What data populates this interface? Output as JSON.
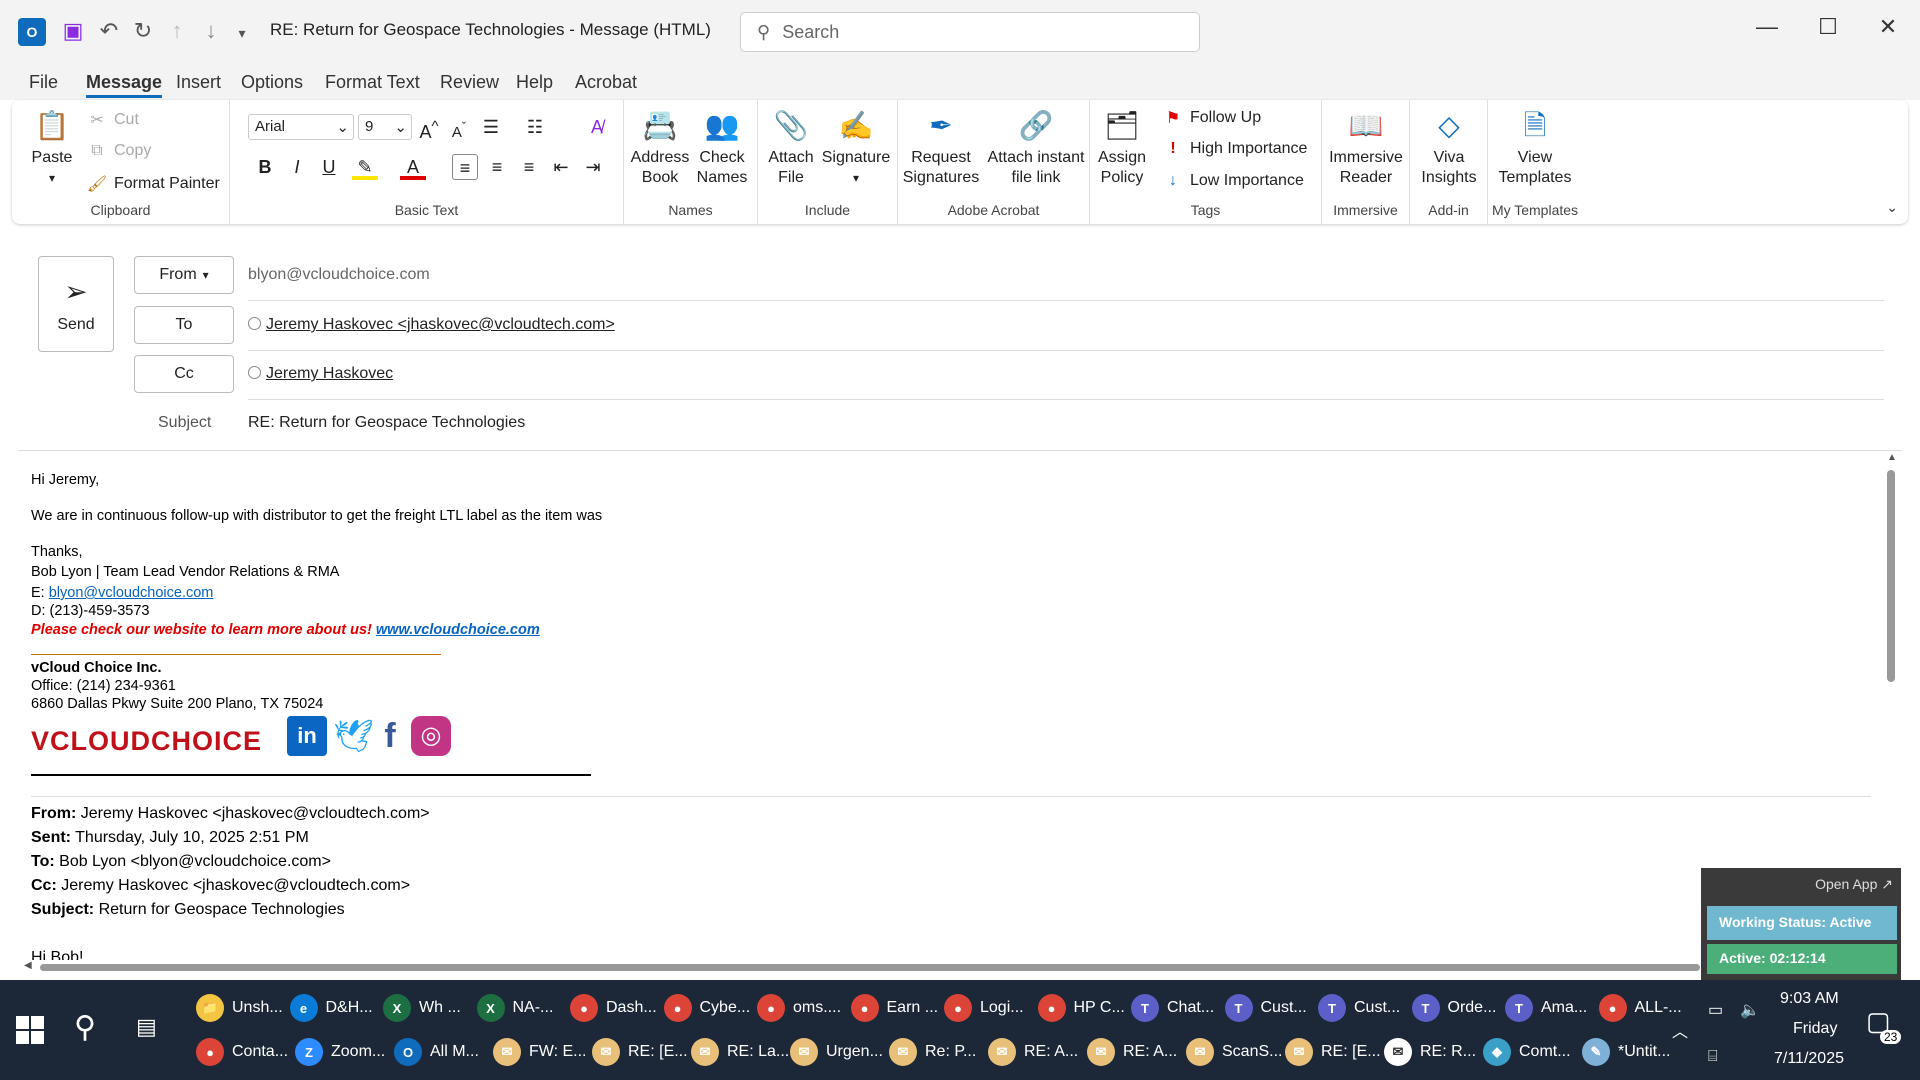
{
  "titlebar": {
    "title": "RE: Return for Geospace Technologies  -  Message (HTML)",
    "search_placeholder": "Search"
  },
  "menu": [
    "File",
    "Message",
    "Insert",
    "Options",
    "Format Text",
    "Review",
    "Help",
    "Acrobat"
  ],
  "menu_active": "Message",
  "ribbon": {
    "clipboard": {
      "paste": "Paste",
      "cut": "Cut",
      "copy": "Copy",
      "format_painter": "Format Painter",
      "label": "Clipboard"
    },
    "basic_text": {
      "font": "Arial",
      "size": "9",
      "label": "Basic Text"
    },
    "names": {
      "address_book": "Address Book",
      "check_names": "Check Names",
      "label": "Names"
    },
    "include": {
      "attach_file": "Attach File",
      "signature": "Signature",
      "label": "Include"
    },
    "adobe": {
      "request_signatures": "Request Signatures",
      "attach_link": "Attach instant file link",
      "label": "Adobe Acrobat"
    },
    "tags": {
      "assign_policy": "Assign Policy",
      "follow_up": "Follow Up",
      "high": "High Importance",
      "low": "Low Importance",
      "label": "Tags"
    },
    "immersive": {
      "reader": "Immersive Reader",
      "label": "Immersive"
    },
    "addin": {
      "viva": "Viva Insights",
      "label": "Add-in"
    },
    "templates": {
      "view": "View Templates",
      "label": "My Templates"
    }
  },
  "compose": {
    "send": "Send",
    "from_btn": "From",
    "from": "blyon@vcloudchoice.com",
    "to_btn": "To",
    "to": "Jeremy Haskovec <jhaskovec@vcloudtech.com>",
    "cc_btn": "Cc",
    "cc": "Jeremy Haskovec",
    "subject_label": "Subject",
    "subject": "RE: Return for Geospace Technologies"
  },
  "body": {
    "greeting": "Hi Jeremy,",
    "line1": "We are in continuous follow-up with distributor to get the freight LTL label as the item was",
    "thanks": "Thanks,",
    "sig_name": "Bob Lyon | Team Lead Vendor Relations & RMA",
    "sig_email_label": "E: ",
    "sig_email": "blyon@vcloudchoice.com",
    "sig_phone": "D: (213)-459-3573",
    "promo": "Please check our website to learn more about us!",
    "promo_link": "www.vcloudchoice.com",
    "company": "vCloud Choice Inc.",
    "office": "Office: (214) 234-9361",
    "address": "6860 Dallas Pkwy Suite 200 Plano, TX 75024",
    "logo": "VCLOUDCHOICE",
    "quoted": {
      "from_label": "From:",
      "from": "Jeremy Haskovec <jhaskovec@vcloudtech.com>",
      "sent_label": "Sent:",
      "sent": "Thursday, July 10, 2025 2:51 PM",
      "to_label": "To:",
      "to": "Bob Lyon <blyon@vcloudchoice.com>",
      "cc_label": "Cc:",
      "cc": "Jeremy Haskovec <jhaskovec@vcloudtech.com>",
      "subject_label": "Subject:",
      "subject": "Return for Geospace Technologies",
      "partial": "Hi Bob!"
    }
  },
  "widget": {
    "open_app": "Open App ↗",
    "status": "Working Status: Active",
    "active": "Active: 02:12:14"
  },
  "taskbar": {
    "row1": [
      "Unsh...",
      "D&H...",
      "Wh ...",
      "NA-...",
      "Dash...",
      "Cybe...",
      "oms....",
      "Earn ...",
      "Logi...",
      "HP C...",
      "Chat...",
      "Cust...",
      "Cust...",
      "Orde...",
      "Ama...",
      "ALL-..."
    ],
    "row2": [
      "Conta...",
      "Zoom...",
      "All M...",
      "FW: E...",
      "RE: [E...",
      "RE: La...",
      "Urgen...",
      "Re: P...",
      "RE: A...",
      "RE: A...",
      "ScanS...",
      "RE: [E...",
      "RE: R...",
      "Comt...",
      "*Untit..."
    ],
    "time": "9:03 AM",
    "day": "Friday",
    "date": "7/11/2025",
    "notif": "23"
  },
  "colors": {
    "accent": "#0f6cbd",
    "taskbar": "#1c2838",
    "widget_green": "#4caf7a"
  }
}
